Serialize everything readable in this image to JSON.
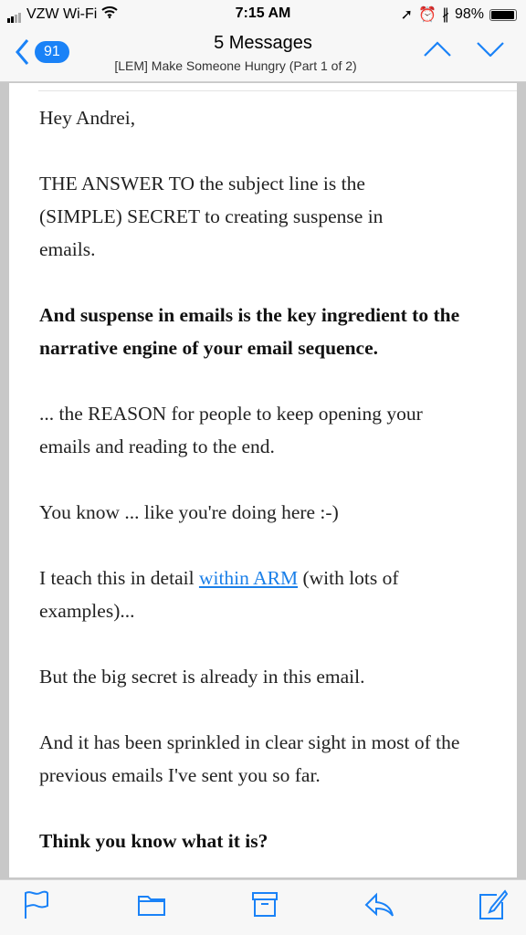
{
  "status": {
    "carrier": "VZW Wi-Fi",
    "time": "7:15 AM",
    "battery": "98%",
    "battery_level": 0.98
  },
  "nav": {
    "unread_count": "91",
    "title": "5 Messages",
    "subject": "[LEM] Make Someone Hungry (Part 1 of 2)"
  },
  "email": {
    "p1": "Hey Andrei,",
    "p2": "THE ANSWER TO the subject line is the (SIMPLE) SECRET to creating suspense in emails.",
    "p3": "And suspense in emails is the key ingredient to the narrative engine of your email sequence.",
    "p4": "... the REASON for people to keep opening your emails and reading to the end.",
    "p5": "You know ... like you're doing here :-)",
    "p6_before": "I teach this in detail ",
    "p6_link": "within ARM",
    "p6_after": " (with lots of examples)...",
    "p7": "But the big secret is already in this email.",
    "p8": "And it has been sprinkled in clear sight in most of the previous emails I've sent you so far.",
    "p9": "Think you know what it is?"
  },
  "toolbar": [
    "flag-icon",
    "folder-icon",
    "archive-icon",
    "reply-icon",
    "compose-icon"
  ],
  "colors": {
    "accent": "#1a82f7",
    "link": "#1a7fe8"
  }
}
